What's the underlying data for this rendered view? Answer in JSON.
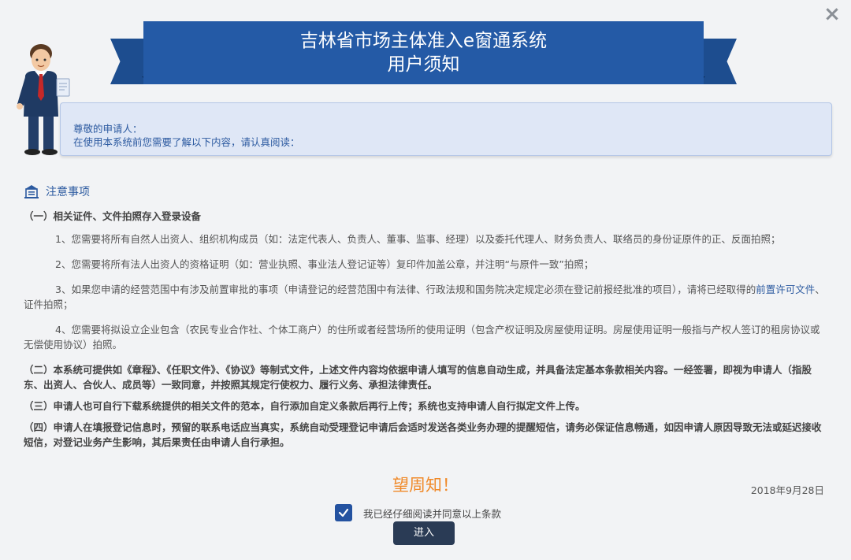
{
  "header": {
    "title": "吉林省市场主体准入e窗通系统",
    "subtitle": "用户须知",
    "close_icon": "×"
  },
  "intro": {
    "line1": "尊敬的申请人：",
    "line2": "在使用本系统前您需要了解以下内容，请认真阅读："
  },
  "notice": {
    "heading": "注意事项",
    "section1_title": "（一）相关证件、文件拍照存入登录设备",
    "items": [
      "1、您需要将所有自然人出资人、组织机构成员（如：法定代表人、负责人、董事、监事、经理）以及委托代理人、财务负责人、联络员的身份证原件的正、反面拍照；",
      "2、您需要将所有法人出资人的资格证明（如：营业执照、事业法人登记证等）复印件加盖公章，并注明“与原件一致”拍照；",
      "3、如果您申请的经营范围中有涉及前置审批的事项（申请登记的经营范围中有法律、行政法规和国务院决定规定必须在登记前报经批准的项目），请将已经取得的",
      "4、您需要将拟设立企业包含（农民专业合作社、个体工商户）的住所或者经营场所的使用证明（包含产权证明及房屋使用证明。房屋使用证明一般指与产权人签订的租房协议或无偿使用协议）拍照。"
    ],
    "item3_link": "前置许可文件",
    "item3_tail": "、证件拍照；",
    "section2": "（二）本系统可提供如《章程》、《任职文件》、《协议》等制式文件，上述文件内容均依据申请人填写的信息自动生成，并具备法定基本条款相关内容。一经签署，即视为申请人（指股东、出资人、合伙人、成员等）一致同意，并按照其规定行使权力、履行义务、承担法律责任。",
    "section3": "（三）申请人也可自行下载系统提供的相关文件的范本，自行添加自定义条款后再行上传；系统也支持申请人自行拟定文件上传。",
    "section4": "（四）申请人在填报登记信息时，预留的联系电话应当真实，系统自动受理登记申请后会适时发送各类业务办理的提醒短信，请务必保证信息畅通，如因申请人原因导致无法或延迟接收短信，对登记业务产生影响，其后果责任由申请人自行承担。",
    "closing": "望周知！",
    "date": "2018年9月28日"
  },
  "agreement": {
    "label": "我已经仔细阅读并同意以上条款",
    "checked": true
  },
  "enter_button": "进入",
  "colors": {
    "banner": "#245aa6",
    "accent_orange": "#f08a2a",
    "link": "#2c5aa0",
    "button": "#2a3b55"
  }
}
